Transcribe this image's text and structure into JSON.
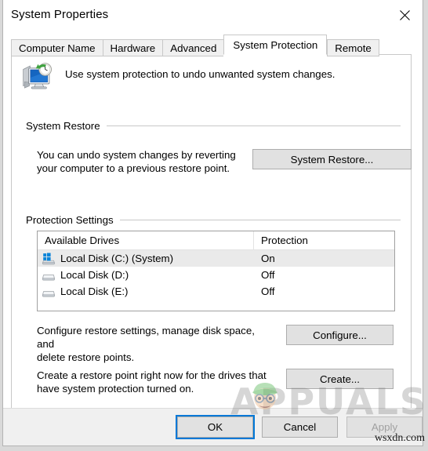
{
  "window": {
    "title": "System Properties",
    "close_icon": "close-icon"
  },
  "tabs": [
    {
      "label": "Computer Name",
      "active": false
    },
    {
      "label": "Hardware",
      "active": false
    },
    {
      "label": "Advanced",
      "active": false
    },
    {
      "label": "System Protection",
      "active": true
    },
    {
      "label": "Remote",
      "active": false
    }
  ],
  "intro": {
    "icon": "system-protection-icon",
    "text": "Use system protection to undo unwanted system changes."
  },
  "system_restore": {
    "group_label": "System Restore",
    "description": "You can undo system changes by reverting\nyour computer to a previous restore point.",
    "button_label": "System Restore..."
  },
  "protection_settings": {
    "group_label": "Protection Settings",
    "columns": [
      "Available Drives",
      "Protection"
    ],
    "rows": [
      {
        "icon": "system-drive-icon",
        "drive": "Local Disk (C:) (System)",
        "protection": "On",
        "selected": true
      },
      {
        "icon": "drive-icon",
        "drive": "Local Disk (D:)",
        "protection": "Off",
        "selected": false
      },
      {
        "icon": "drive-icon",
        "drive": "Local Disk (E:)",
        "protection": "Off",
        "selected": false
      }
    ],
    "configure": {
      "description": "Configure restore settings, manage disk space, and\ndelete restore points.",
      "button_label": "Configure..."
    },
    "create": {
      "description": "Create a restore point right now for the drives that\nhave system protection turned on.",
      "button_label": "Create..."
    }
  },
  "footer": {
    "ok_label": "OK",
    "cancel_label": "Cancel",
    "apply_label": "Apply"
  },
  "watermark": {
    "brand": "APPUALS",
    "site": "wsxdn.com"
  },
  "colors": {
    "accent": "#0078d7",
    "window_bg": "#ffffff",
    "footer_bg": "#f0f0f0",
    "button_bg": "#e1e1e1",
    "selection": "#eaeaea"
  }
}
